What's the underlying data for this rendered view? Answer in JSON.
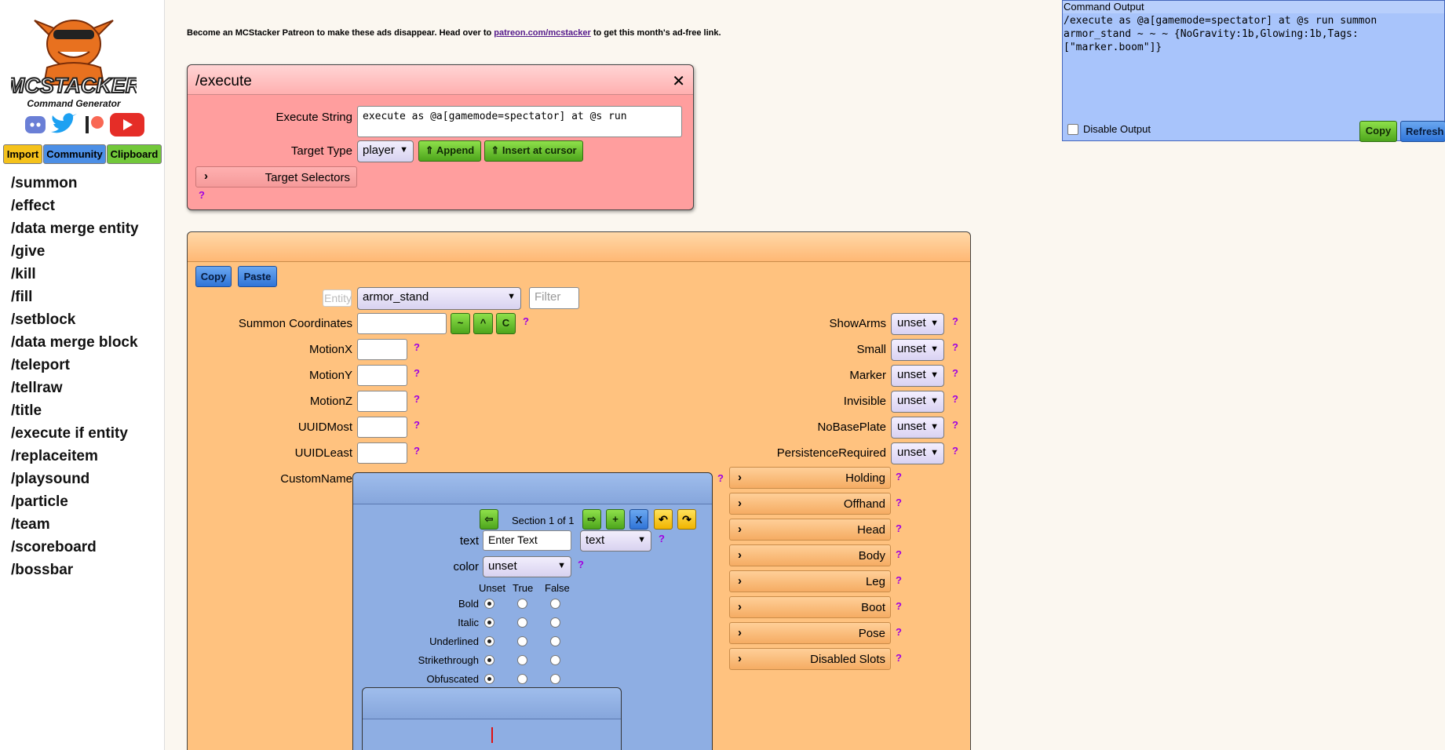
{
  "brand": {
    "name": "MCStacker",
    "tagline": "Command Generator"
  },
  "topbuttons": {
    "import": "Import",
    "community": "Community",
    "clipboard": "Clipboard"
  },
  "nav": [
    "/summon",
    "/effect",
    "/data merge entity",
    "/give",
    "/kill",
    "/fill",
    "/setblock",
    "/data merge block",
    "/teleport",
    "/tellraw",
    "/title",
    "/execute if entity",
    "/replaceitem",
    "/playsound",
    "/particle",
    "/team",
    "/scoreboard",
    "/bossbar"
  ],
  "ad": {
    "before": "Become an MCStacker Patreon to make these ads disappear. Head over to ",
    "link": "patreon.com/mcstacker",
    "after": " to get this month's ad-free link."
  },
  "execute": {
    "title": "/execute",
    "close": "✕",
    "string_label": "Execute String",
    "string_value": "execute as @a[gamemode=spectator] at @s run",
    "target_label": "Target Type",
    "target_value": "player",
    "append": "⇑ Append",
    "insert": "⇑ Insert at cursor",
    "selectors": "Target Selectors",
    "help": "?"
  },
  "main": {
    "copy": "Copy",
    "paste": "Paste",
    "entity_placeholder": "Entity",
    "entity_value": "armor_stand",
    "filter_placeholder": "Filter",
    "coords_label": "Summon Coordinates",
    "coord_btns": [
      "~",
      "^",
      "C"
    ],
    "left_fields": [
      "MotionX",
      "MotionY",
      "MotionZ",
      "UUIDMost",
      "UUIDLeast"
    ],
    "customname_label": "CustomName",
    "right_flags": [
      {
        "label": "ShowArms",
        "value": "unset"
      },
      {
        "label": "Small",
        "value": "unset"
      },
      {
        "label": "Marker",
        "value": "unset"
      },
      {
        "label": "Invisible",
        "value": "unset"
      },
      {
        "label": "NoBasePlate",
        "value": "unset"
      },
      {
        "label": "PersistenceRequired",
        "value": "unset"
      }
    ],
    "right_sections": [
      "Holding",
      "Offhand",
      "Head",
      "Body",
      "Leg",
      "Boot",
      "Pose",
      "Disabled Slots"
    ],
    "help": "?"
  },
  "json": {
    "section": "Section 1 of 1",
    "nav_btns": {
      "prev": "⇦",
      "next": "⇨",
      "add": "+",
      "del": "X",
      "undo": "↶",
      "redo": "↷"
    },
    "text_label": "text",
    "text_placeholder": "Enter Text",
    "text_type": "text",
    "color_label": "color",
    "color_value": "unset",
    "cols": [
      "Unset",
      "True",
      "False"
    ],
    "styles": [
      "Bold",
      "Italic",
      "Underlined",
      "Strikethrough",
      "Obfuscated"
    ]
  },
  "output": {
    "header": "Command Output",
    "text": "/execute as @a[gamemode=spectator] at @s run summon armor_stand ~ ~ ~ {NoGravity:1b,Glowing:1b,Tags:[\"marker.boom\"]}",
    "disable": "Disable Output",
    "copy": "Copy",
    "refresh": "Refresh"
  }
}
